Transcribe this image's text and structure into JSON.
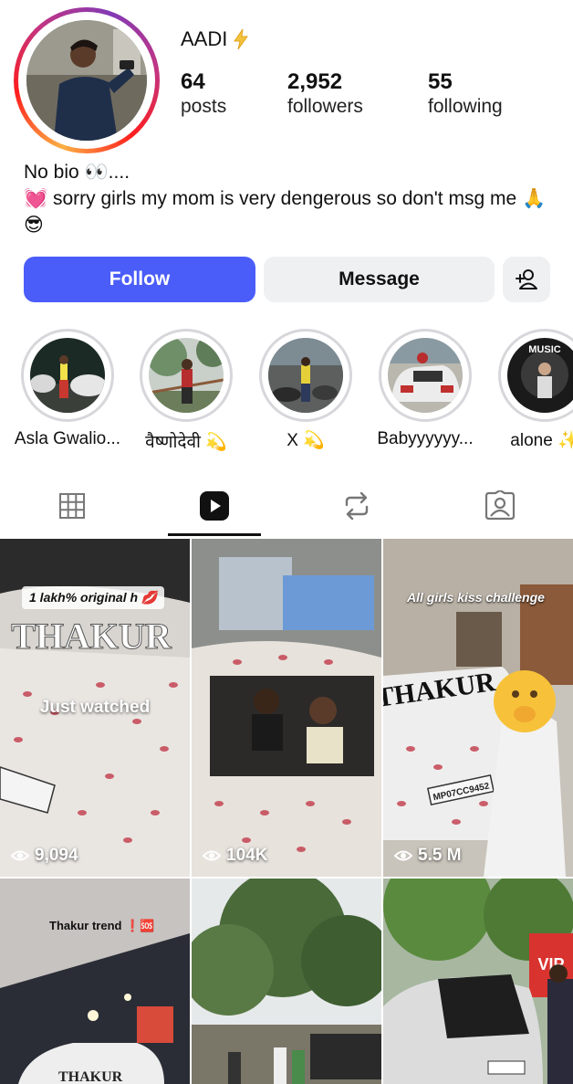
{
  "profile": {
    "username": "AADI",
    "username_icon": "lightning-emoji",
    "stats": {
      "posts_count": "64",
      "posts_label": "posts",
      "followers_count": "2,952",
      "followers_label": "followers",
      "following_count": "55",
      "following_label": "following"
    },
    "bio_line1": "No bio 👀....",
    "bio_line2": "💓 sorry girls my mom is very dengerous so don't msg me 🙏😎"
  },
  "actions": {
    "follow_label": "Follow",
    "message_label": "Message",
    "add_user_icon": "person-add-icon"
  },
  "highlights": [
    {
      "label": "Asla Gwalio..."
    },
    {
      "label": "वैष्णोदेवी 💫"
    },
    {
      "label": "X 💫"
    },
    {
      "label": "Babyyyyyy..."
    },
    {
      "label": "alone ✨"
    }
  ],
  "highlight_overlay_text": "MUSIC",
  "tabs": [
    {
      "icon": "grid-icon",
      "active": false
    },
    {
      "icon": "reels-icon",
      "active": true
    },
    {
      "icon": "reposts-icon",
      "active": false
    },
    {
      "icon": "tagged-icon",
      "active": false
    }
  ],
  "reels": [
    {
      "overlay": "1 lakh% original h 💋",
      "car_text": "THAKUR",
      "status": "Just watched",
      "views": "9,094"
    },
    {
      "overlay": "",
      "views": "104K"
    },
    {
      "overlay": "All girls kiss challenge",
      "car_text": "THAKUR",
      "plate": "MP07CC9452",
      "views": "5.5 M"
    },
    {
      "overlay": "Thakur trend ❗🆘",
      "car_text": "THAKUR"
    },
    {
      "overlay": ""
    },
    {
      "overlay": "",
      "side_text": "VIP"
    }
  ],
  "colors": {
    "follow_button": "#4a5df9",
    "secondary_button": "#eff0f2",
    "highlight_ring": "#d7d7db"
  }
}
